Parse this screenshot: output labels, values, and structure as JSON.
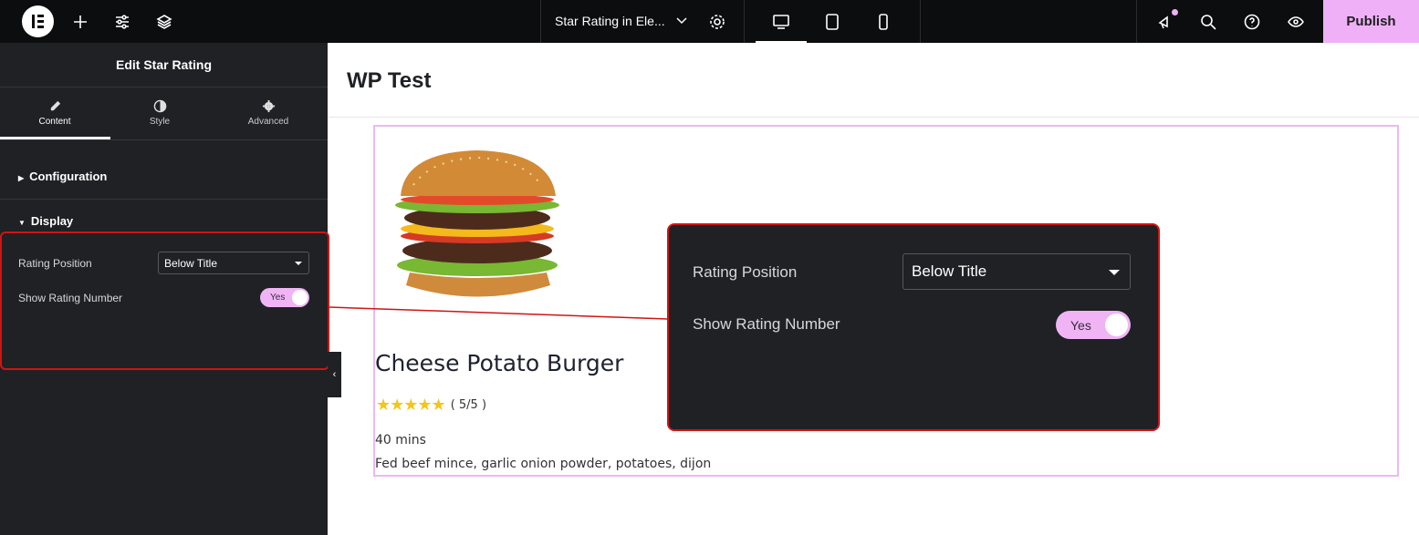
{
  "topbar": {
    "document_title": "Star Rating in Ele...",
    "publish_label": "Publish",
    "accent": "#efb0f7"
  },
  "sidebar": {
    "title": "Edit Star Rating",
    "tabs": [
      {
        "label": "Content",
        "icon": "pencil-icon",
        "active": true
      },
      {
        "label": "Style",
        "icon": "contrast-icon"
      },
      {
        "label": "Advanced",
        "icon": "gear-icon"
      }
    ],
    "sections": [
      {
        "label": "Configuration",
        "expanded": false
      },
      {
        "label": "Display",
        "expanded": true
      }
    ],
    "controls": {
      "rating_position_label": "Rating Position",
      "rating_position_value": "Below Title",
      "show_rating_number_label": "Show Rating Number",
      "show_rating_number_value": "Yes"
    }
  },
  "canvas": {
    "site_title": "WP Test",
    "card": {
      "title": "Cheese Potato Burger",
      "stars": 5,
      "rating_text": "( 5/5 )",
      "time": "40 mins",
      "ingredients": "Fed beef mince, garlic onion powder, potatoes, dijon"
    }
  },
  "callout": {
    "rating_position_label": "Rating Position",
    "rating_position_value": "Below Title",
    "show_rating_number_label": "Show Rating Number",
    "show_rating_number_value": "Yes",
    "highlight_color": "#d11414"
  }
}
